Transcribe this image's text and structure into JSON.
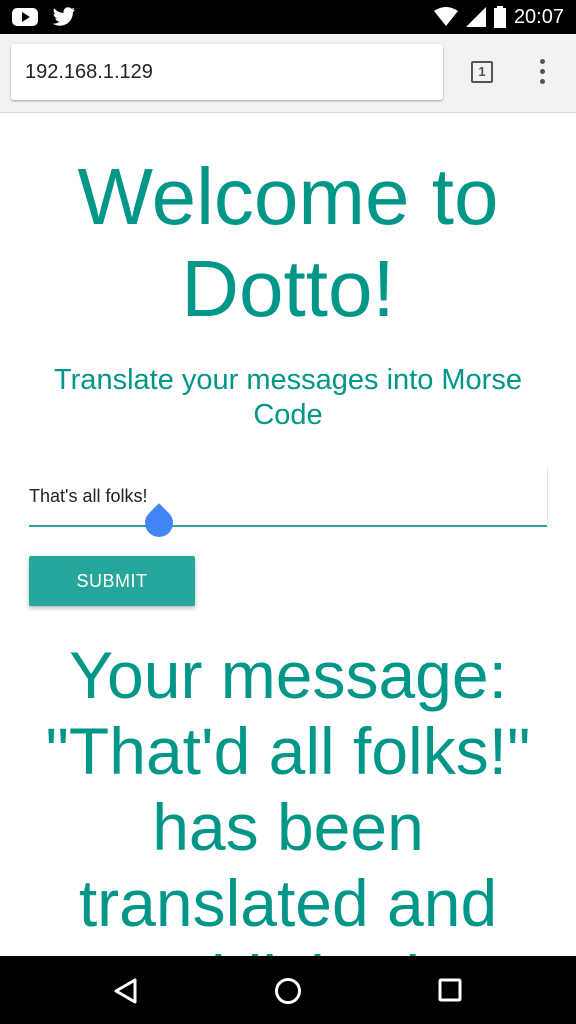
{
  "status_bar": {
    "time": "20:07",
    "icons": [
      "youtube-icon",
      "twitter-icon",
      "wifi-icon",
      "cell-signal-icon",
      "battery-icon"
    ]
  },
  "browser": {
    "url": "192.168.1.129",
    "tab_count": "1"
  },
  "page": {
    "title": "Welcome to Dotto!",
    "subtitle": "Translate your messages into Morse Code",
    "input_value": "That's all folks!",
    "submit_label": "SUBMIT",
    "result_text": "Your message: \"That'd all folks!\" has been translated and published!"
  },
  "nav_bar": {
    "icons": [
      "back-icon",
      "home-icon",
      "recents-icon"
    ]
  },
  "colors": {
    "accent": "#009688",
    "button": "#26a69a",
    "cursor_handle": "#4285f4"
  }
}
